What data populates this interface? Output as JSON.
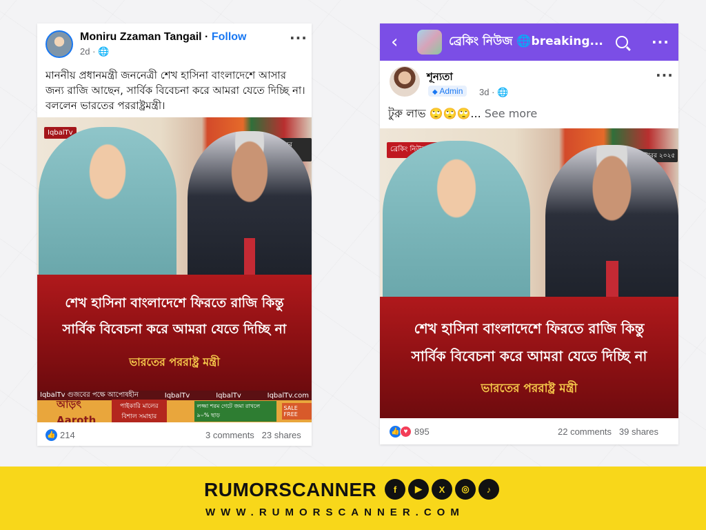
{
  "left_post": {
    "author": "Moniru Zzaman Tangail",
    "follow_label": "Follow",
    "separator": " · ",
    "time": "2d",
    "privacy_icon": "globe-icon",
    "text": "মাননীয় প্রধানমন্ত্রী জননেত্রী শেখ হাসিনা বাংলাদেশে আসার জন্য রাজি আছেন, সার্বিক বিবেচনা করে আমরা যেতে দিচ্ছি না। বললেন ভারতের পররাষ্ট্রমন্ত্রী।",
    "image": {
      "brand": "IqbalTv",
      "date": "২৭ অক্টোবর ২০২৫",
      "headline_1": "শেখ হাসিনা বাংলাদেশে ফিরতে রাজি কিন্তু",
      "headline_2": "সার্বিক বিবেচনা করে আমরা যেতে দিচ্ছি না",
      "attribution": "ভারতের পররাষ্ট্র মন্ত্রী",
      "footer_left": "IqbalTv গুজবের পক্ষে আপোষহীন",
      "footer_mid1": "IqbalTv",
      "footer_mid2": "IqbalTv",
      "footer_right": "IqbalTv.com",
      "ad_logo": "আড়ৎ Aaroth",
      "ad_text": "পাইকারি মালের বিশাল সমাহার",
      "ad_promo": "লজ্জা শরম গেটে জমা রাখলে ৯০% ছাড়",
      "ad_sale": "SALE FREE"
    },
    "likes": "214",
    "comments": "3 comments",
    "shares": "23 shares"
  },
  "right_post": {
    "group_name": "ব্রেকিং নিউজ 🌐breaking...",
    "author": "শূন্যতা",
    "badge": "Admin",
    "time": "3d",
    "separator": " · ",
    "privacy_icon": "globe-icon",
    "text": "টুরু লাভ 🙄🙄🙄...",
    "see_more": "See more",
    "image": {
      "brand": "ব্রেকিং নিউজ:😵",
      "date": "২৭ অক্টোবর ২০২৫",
      "headline_1": "শেখ হাসিনা বাংলাদেশে ফিরতে রাজি কিন্তু",
      "headline_2": "সার্বিক বিবেচনা করে আমরা যেতে দিচ্ছি না",
      "attribution": "ভারতের পররাষ্ট্র মন্ত্রী"
    },
    "reactions": "895",
    "comments": "22 comments",
    "shares": "39 shares"
  },
  "footer": {
    "brand": "RUMORSCANNER",
    "url": "WWW.RUMORSCANNER.COM",
    "socials": [
      "f",
      "▶",
      "X",
      "◎",
      "♪"
    ]
  },
  "colors": {
    "facebook_blue": "#1877f2",
    "group_purple": "#7b4ee6",
    "banner_red": "#8c1013",
    "footer_yellow": "#f8d71a"
  }
}
